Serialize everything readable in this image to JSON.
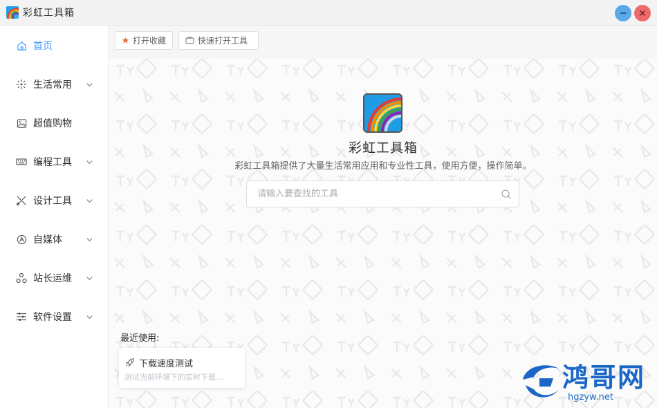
{
  "app": {
    "title": "彩虹工具箱"
  },
  "window_controls": {
    "minimize_icon": "minimize-icon",
    "close_icon": "close-icon"
  },
  "sidebar": {
    "items": [
      {
        "label": "首页",
        "icon": "home-icon",
        "active": true,
        "has_children": false
      },
      {
        "label": "生活常用",
        "icon": "sparkle-icon",
        "active": false,
        "has_children": true
      },
      {
        "label": "超值购物",
        "icon": "image-icon",
        "active": false,
        "has_children": false
      },
      {
        "label": "编程工具",
        "icon": "keyboard-icon",
        "active": false,
        "has_children": true
      },
      {
        "label": "设计工具",
        "icon": "design-tools-icon",
        "active": false,
        "has_children": true
      },
      {
        "label": "自媒体",
        "icon": "media-icon",
        "active": false,
        "has_children": true
      },
      {
        "label": "站长运维",
        "icon": "network-icon",
        "active": false,
        "has_children": true
      },
      {
        "label": "软件设置",
        "icon": "sliders-icon",
        "active": false,
        "has_children": true
      }
    ]
  },
  "toolbar": {
    "favorites_label": "打开收藏",
    "quick_open_label": "快速打开工具"
  },
  "hero": {
    "title": "彩虹工具箱",
    "description": "彩虹工具箱提供了大量生活常用应用和专业性工具，使用方便，操作简单。"
  },
  "search": {
    "placeholder": "请输入要查找的工具",
    "value": ""
  },
  "recent": {
    "label": "最近使用:",
    "items": [
      {
        "title": "下载速度测试",
        "description": "测试当前环境下的实时下载...",
        "icon": "rocket-icon"
      }
    ]
  },
  "watermark": {
    "text": "鸿哥网",
    "url": "hgzyw.net"
  },
  "colors": {
    "accent": "#409eff",
    "minimize": "#5aa8e8",
    "close": "#ee6a6a",
    "watermark": "#1a67c8"
  }
}
